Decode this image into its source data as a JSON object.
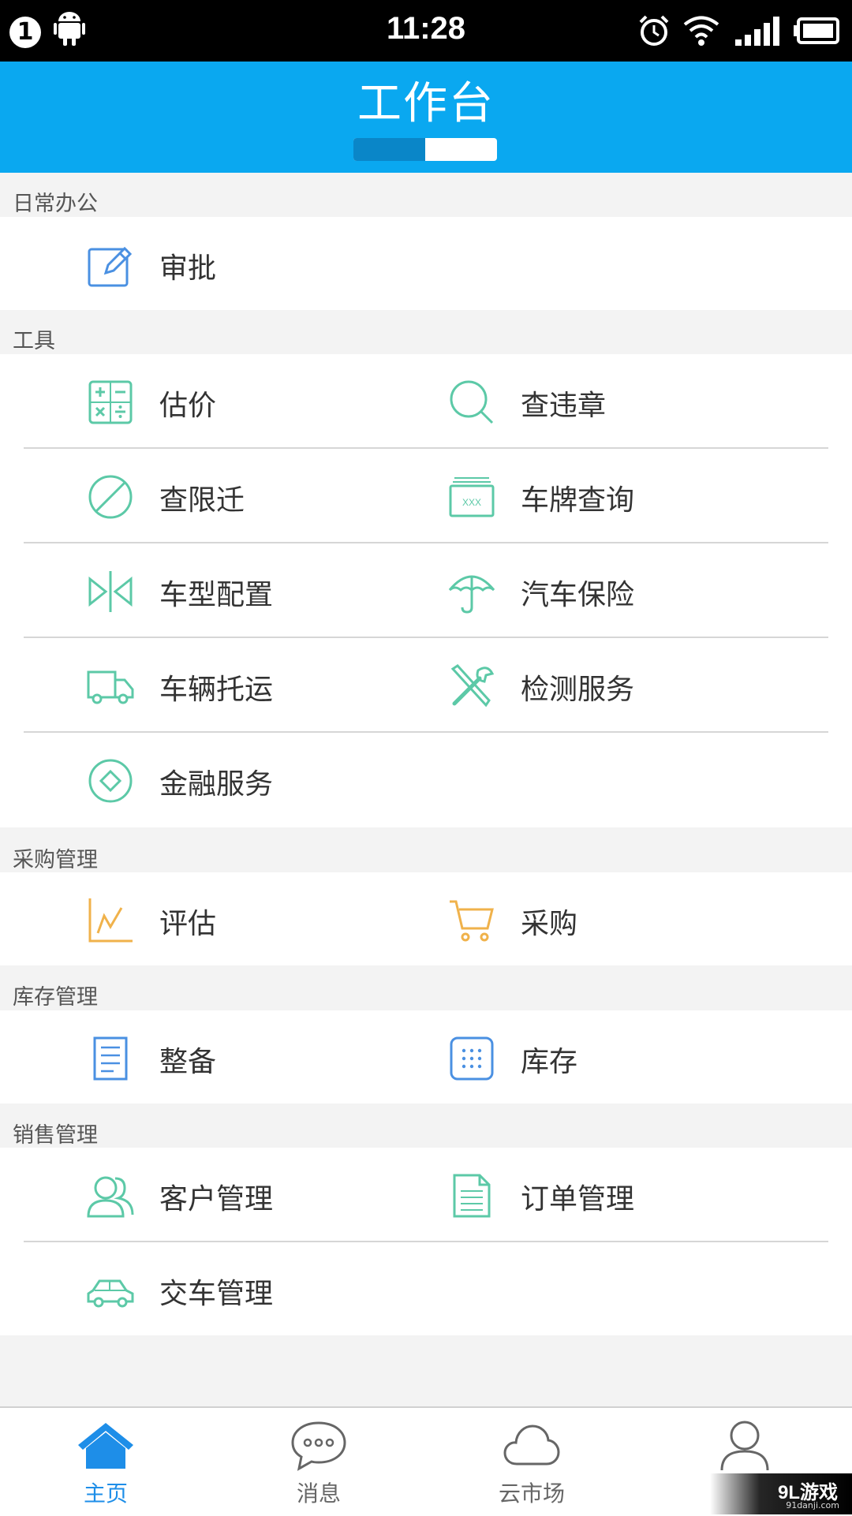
{
  "status_bar": {
    "notification_count": "1",
    "time": "11:28"
  },
  "header": {
    "title": "工作台",
    "progress": 0.5,
    "accent": "#0aa8f0"
  },
  "sections": {
    "daily": {
      "label": "日常办公",
      "items": {
        "approval": "审批"
      }
    },
    "tools": {
      "label": "工具",
      "items": {
        "estimate": "估价",
        "violation": "查违章",
        "restriction": "查限迁",
        "plate": "车牌查询",
        "plate_text": "XXX",
        "config": "车型配置",
        "insurance": "汽车保险",
        "shipping": "车辆托运",
        "inspection": "检测服务",
        "finance": "金融服务"
      }
    },
    "purchase": {
      "label": "采购管理",
      "items": {
        "evaluate": "评估",
        "buy": "采购"
      }
    },
    "inventory": {
      "label": "库存管理",
      "items": {
        "prep": "整备",
        "stock": "库存"
      }
    },
    "sales": {
      "label": "销售管理",
      "items": {
        "customers": "客户管理",
        "orders": "订单管理",
        "delivery": "交车管理"
      }
    }
  },
  "tabbar": {
    "home": "主页",
    "messages": "消息",
    "cloud_market": "云市场"
  },
  "watermark": {
    "brand": "9L游戏",
    "site": "91danji.com"
  },
  "colors": {
    "blue_icon": "#4a90e2",
    "green_icon": "#5cc9a7",
    "orange_icon": "#f0b24b",
    "tab_active": "#1e8ee8"
  }
}
